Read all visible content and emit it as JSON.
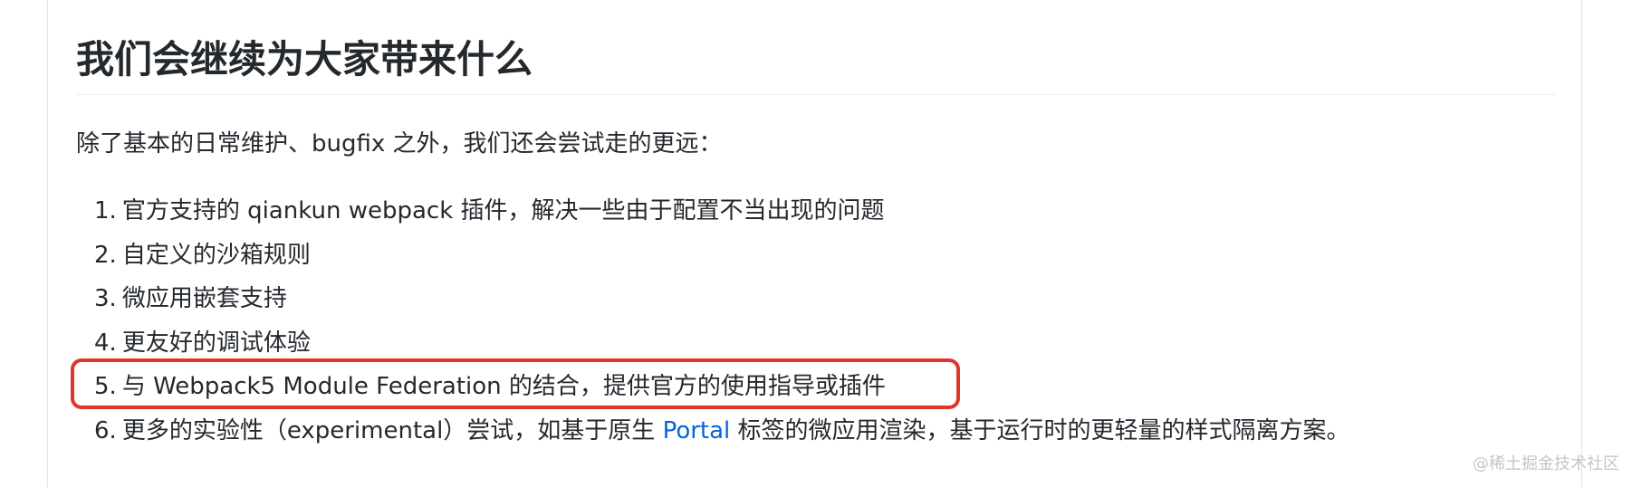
{
  "heading": "我们会继续为大家带来什么",
  "intro": "除了基本的日常维护、bugfix 之外，我们还会尝试走的更远：",
  "list": [
    {
      "num": "1.",
      "text": "官方支持的 qiankun webpack 插件，解决一些由于配置不当出现的问题"
    },
    {
      "num": "2.",
      "text": "自定义的沙箱规则"
    },
    {
      "num": "3.",
      "text": "微应用嵌套支持"
    },
    {
      "num": "4.",
      "text": "更友好的调试体验"
    },
    {
      "num": "5.",
      "text": "与 Webpack5 Module Federation 的结合，提供官方的使用指导或插件"
    },
    {
      "num": "6.",
      "text_before": "更多的实验性（experimental）尝试，如基于原生 ",
      "link": "Portal",
      "text_after": " 标签的微应用渲染，基于运行时的更轻量的样式隔离方案。"
    }
  ],
  "watermark": "@稀土掘金技术社区",
  "colors": {
    "text": "#24292e",
    "link": "#0366d6",
    "highlight_border": "#e0352b",
    "rule": "#eaecef"
  }
}
